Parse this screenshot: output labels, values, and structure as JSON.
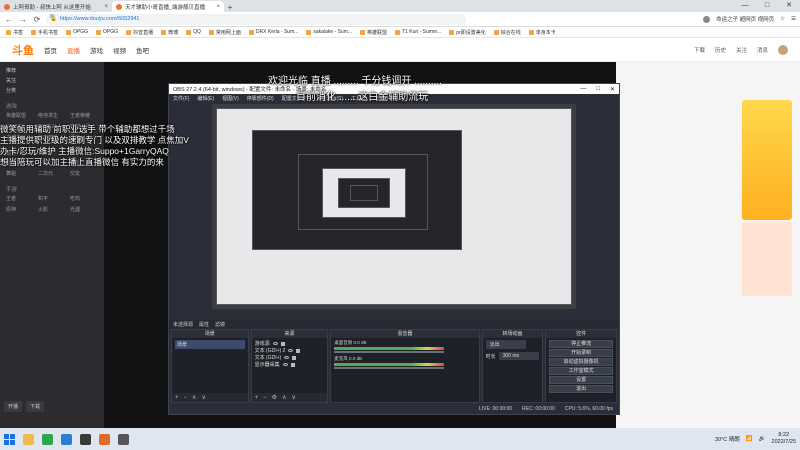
{
  "browser": {
    "tabs": [
      {
        "label": "上阿哥助 - 叔快上阿 从这里开始",
        "active": false
      },
      {
        "label": "天才辅助小哥直播_端游靓贝直播",
        "active": true
      }
    ],
    "new_tab": "+",
    "window_controls": [
      "—",
      "□",
      "✕"
    ],
    "nav": {
      "back": "←",
      "forward": "→",
      "reload": "⟳"
    },
    "url_host": "斗鱼-每个人的直播平台",
    "url": "https://www.douyu.com/6052941",
    "addr_right": [
      "命运之子 超网页 视网页",
      "☆",
      "☰"
    ],
    "bookmarks": [
      "书签",
      "手机书签",
      "OPGG",
      "OPGG",
      "抖音直播",
      "微博",
      "QQ",
      "常用网上面",
      "DRX Kerla - Sum...",
      "sakalake - Sum...",
      "英雄联盟",
      "T1 Kuri - Summ...",
      "pr即设置美化",
      "综合在线",
      "单身本卡"
    ]
  },
  "site": {
    "logo": "斗鱼",
    "nav": [
      "首页",
      "直播",
      "游戏",
      "视频",
      "鱼吧"
    ],
    "header_right": [
      "下载",
      "历史",
      "关注",
      "消息"
    ]
  },
  "left_nav": {
    "top_items": [
      "推荐",
      "关注",
      "分类"
    ],
    "section1": "游戏",
    "grid1": [
      "英雄联盟",
      "绝地求生",
      "王者荣耀",
      "CS:GO",
      "DOTA2",
      "穿越火线",
      "主机游戏",
      "和平精英",
      "原神"
    ],
    "section2": "娱乐",
    "grid2": [
      "颜值",
      "户外",
      "音乐",
      "舞蹈",
      "二次元",
      "交友"
    ],
    "section3": "手游",
    "grid3": [
      "王者",
      "和平",
      "吃鸡",
      "原神",
      "火影",
      "光遇"
    ],
    "footer": [
      "开播",
      "下载"
    ]
  },
  "overlay": {
    "title": "欢迎光临 直播 ......... 千分钱调开 ..........",
    "subtitle": "目前消化 ...... 这白金辅助流玩",
    "left_lines": [
      "微笑帧用辅助 前职业选手 带个辅助都想过千场",
      "主播提供职业级的速刷专门 以及双排教学 点焦加V",
      "办卡/忍玩/维护 主播微信:Suppo+1GarryQAQ",
      "想当陪玩可以加主播上直播微信 有实力的来"
    ]
  },
  "obs": {
    "title": "OBS 27.2.4 (64-bit, windows) - 配置文件: 未命名 - 场景: 未命名",
    "window_controls": [
      "—",
      "□",
      "✕"
    ],
    "menu": [
      "文件(F)",
      "编辑(E)",
      "视图(V)",
      "停靠部件(D)",
      "配置文件(P)",
      "场景集合(S)",
      "工具(T)",
      "帮助(H)"
    ],
    "toolbar": {
      "no_source": "未选择源",
      "properties": "属性",
      "filters": "滤镜"
    },
    "docks": {
      "scenes": {
        "title": "场景",
        "items": [
          "场景"
        ]
      },
      "sources": {
        "title": "来源",
        "items": [
          "游戏源",
          "文本 (GDI+) 2",
          "文本 (GDI+)",
          "显示器采集"
        ]
      },
      "mixer": {
        "title": "混音器",
        "channels": [
          {
            "name": "桌面音频",
            "level": "0.0 dB"
          },
          {
            "name": "麦克风",
            "level": "0.0 dB"
          }
        ]
      },
      "transitions": {
        "title": "转场动画",
        "type": "淡出",
        "duration_label": "时长",
        "duration": "300 ms"
      },
      "controls": {
        "title": "控件",
        "buttons": [
          "停止推流",
          "开始录制",
          "启动虚拟摄像机",
          "工作室模式",
          "设置",
          "退出"
        ]
      }
    },
    "status": {
      "live": "LIVE: 00:00:00",
      "rec": "REC: 00:00:00",
      "cpu": "CPU: 5.6%, 60.00 fps"
    }
  },
  "taskbar": {
    "weather": "30°C 晴朗",
    "time": "8:22",
    "date": "2022/7/25"
  }
}
